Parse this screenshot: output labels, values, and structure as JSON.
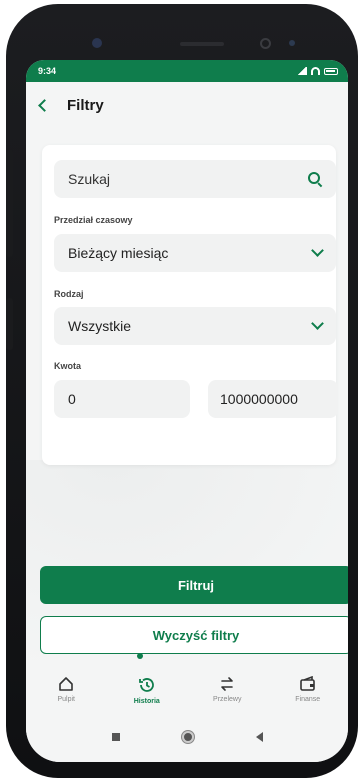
{
  "status": {
    "time": "9:34",
    "icons": [
      "signal-icon",
      "wifi-icon",
      "battery-icon"
    ]
  },
  "header": {
    "title": "Filtry",
    "back_icon": "chevron-left-icon"
  },
  "filters": {
    "search_placeholder": "Szukaj",
    "period_label": "Przedział czasowy",
    "period_value": "Bieżący miesiąc",
    "type_label": "Rodzaj",
    "type_value": "Wszystkie",
    "amount_label": "Kwota",
    "amount_from": "0",
    "amount_to": "1000000000"
  },
  "actions": {
    "apply": "Filtruj",
    "clear": "Wyczyść filtry"
  },
  "nav": {
    "items": [
      {
        "label": "Pulpit",
        "icon": "home-icon"
      },
      {
        "label": "Historia",
        "icon": "history-icon",
        "active": true
      },
      {
        "label": "Przelewy",
        "icon": "transfer-icon"
      },
      {
        "label": "Finanse",
        "icon": "finance-icon"
      }
    ]
  },
  "colors": {
    "accent": "#0f7d4c",
    "background": "#f4f5f5",
    "card": "#ffffff"
  }
}
